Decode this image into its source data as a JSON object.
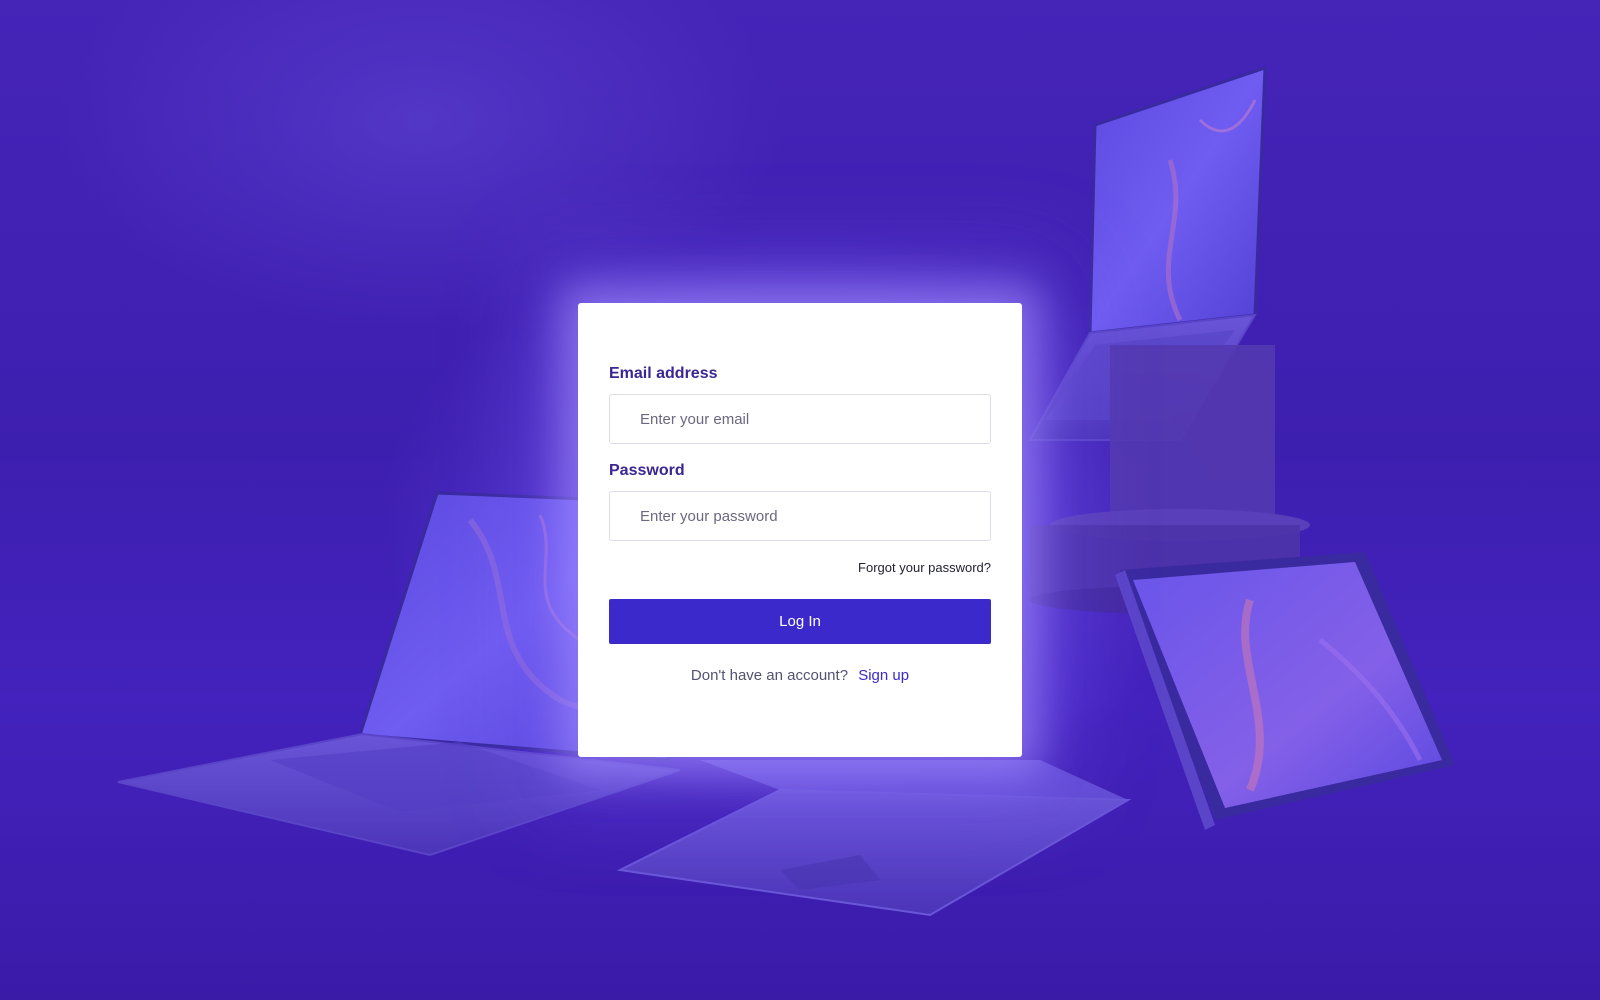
{
  "login": {
    "email_label": "Email address",
    "email_placeholder": "Enter your email",
    "email_value": "",
    "password_label": "Password",
    "password_placeholder": "Enter your password",
    "password_value": "",
    "forgot_link": "Forgot your password?",
    "submit_label": "Log In",
    "signup_prompt": "Don't have an account?",
    "signup_link": "Sign up"
  },
  "colors": {
    "background": "#3d1fb0",
    "accent": "#3b29cc",
    "label": "#3a2694",
    "card": "#ffffff"
  }
}
